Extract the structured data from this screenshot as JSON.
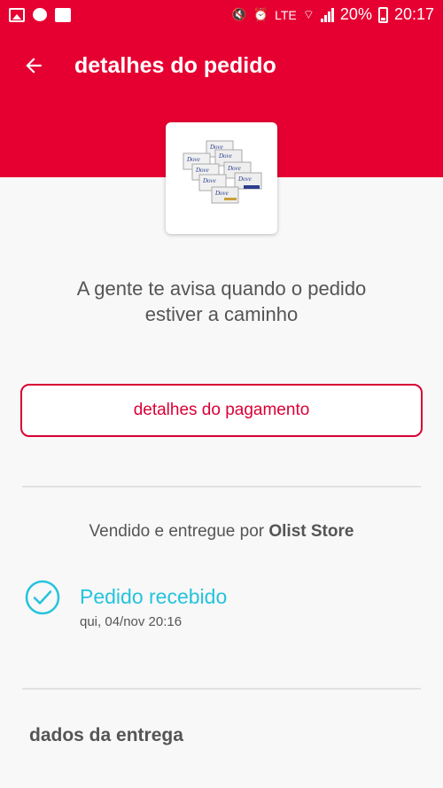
{
  "status_bar": {
    "battery": "20%",
    "time": "20:17",
    "network": "LTE"
  },
  "header": {
    "title": "detalhes do pedido"
  },
  "order": {
    "info_line1": "A gente te avisa quando o pedido",
    "info_line2": "estiver a caminho",
    "payment_button": "detalhes do pagamento",
    "seller_prefix": "Vendido e entregue por",
    "seller_name": "Olist Store",
    "status_title": "Pedido recebido",
    "status_date": "qui, 04/nov 20:16"
  },
  "delivery": {
    "section_title": "dados da entrega"
  },
  "product": {
    "brand_text": "Dove"
  },
  "colors": {
    "primary": "#e60032",
    "accent": "#24c3dd"
  }
}
